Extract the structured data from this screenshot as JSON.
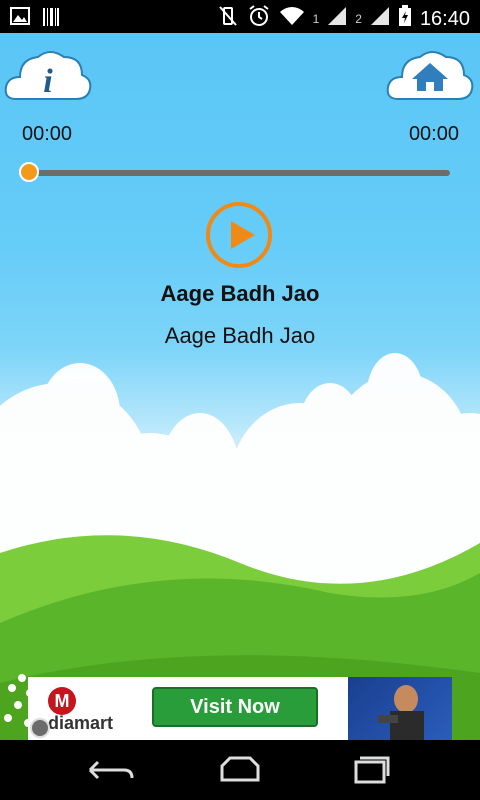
{
  "statusbar": {
    "time": "16:40",
    "sim1_label": "1",
    "sim2_label": "2",
    "icons": [
      "gallery-icon",
      "barcode-icon",
      "vibrate-off-icon",
      "alarm-icon",
      "wifi-icon",
      "signal-icon",
      "battery-icon"
    ]
  },
  "player": {
    "current_time": "00:00",
    "total_time": "00:00",
    "progress": 0,
    "title": "Aage Badh Jao",
    "subtitle": "Aage Badh Jao",
    "accent_color": "#f39a1d"
  },
  "header": {
    "info_icon": "info-icon",
    "home_icon": "home-icon"
  },
  "ad": {
    "brand": "diamart",
    "brand_initial": "M",
    "cta": "Visit Now"
  },
  "navbar": {
    "icons": [
      "back-icon",
      "home-icon",
      "recent-apps-icon"
    ]
  }
}
